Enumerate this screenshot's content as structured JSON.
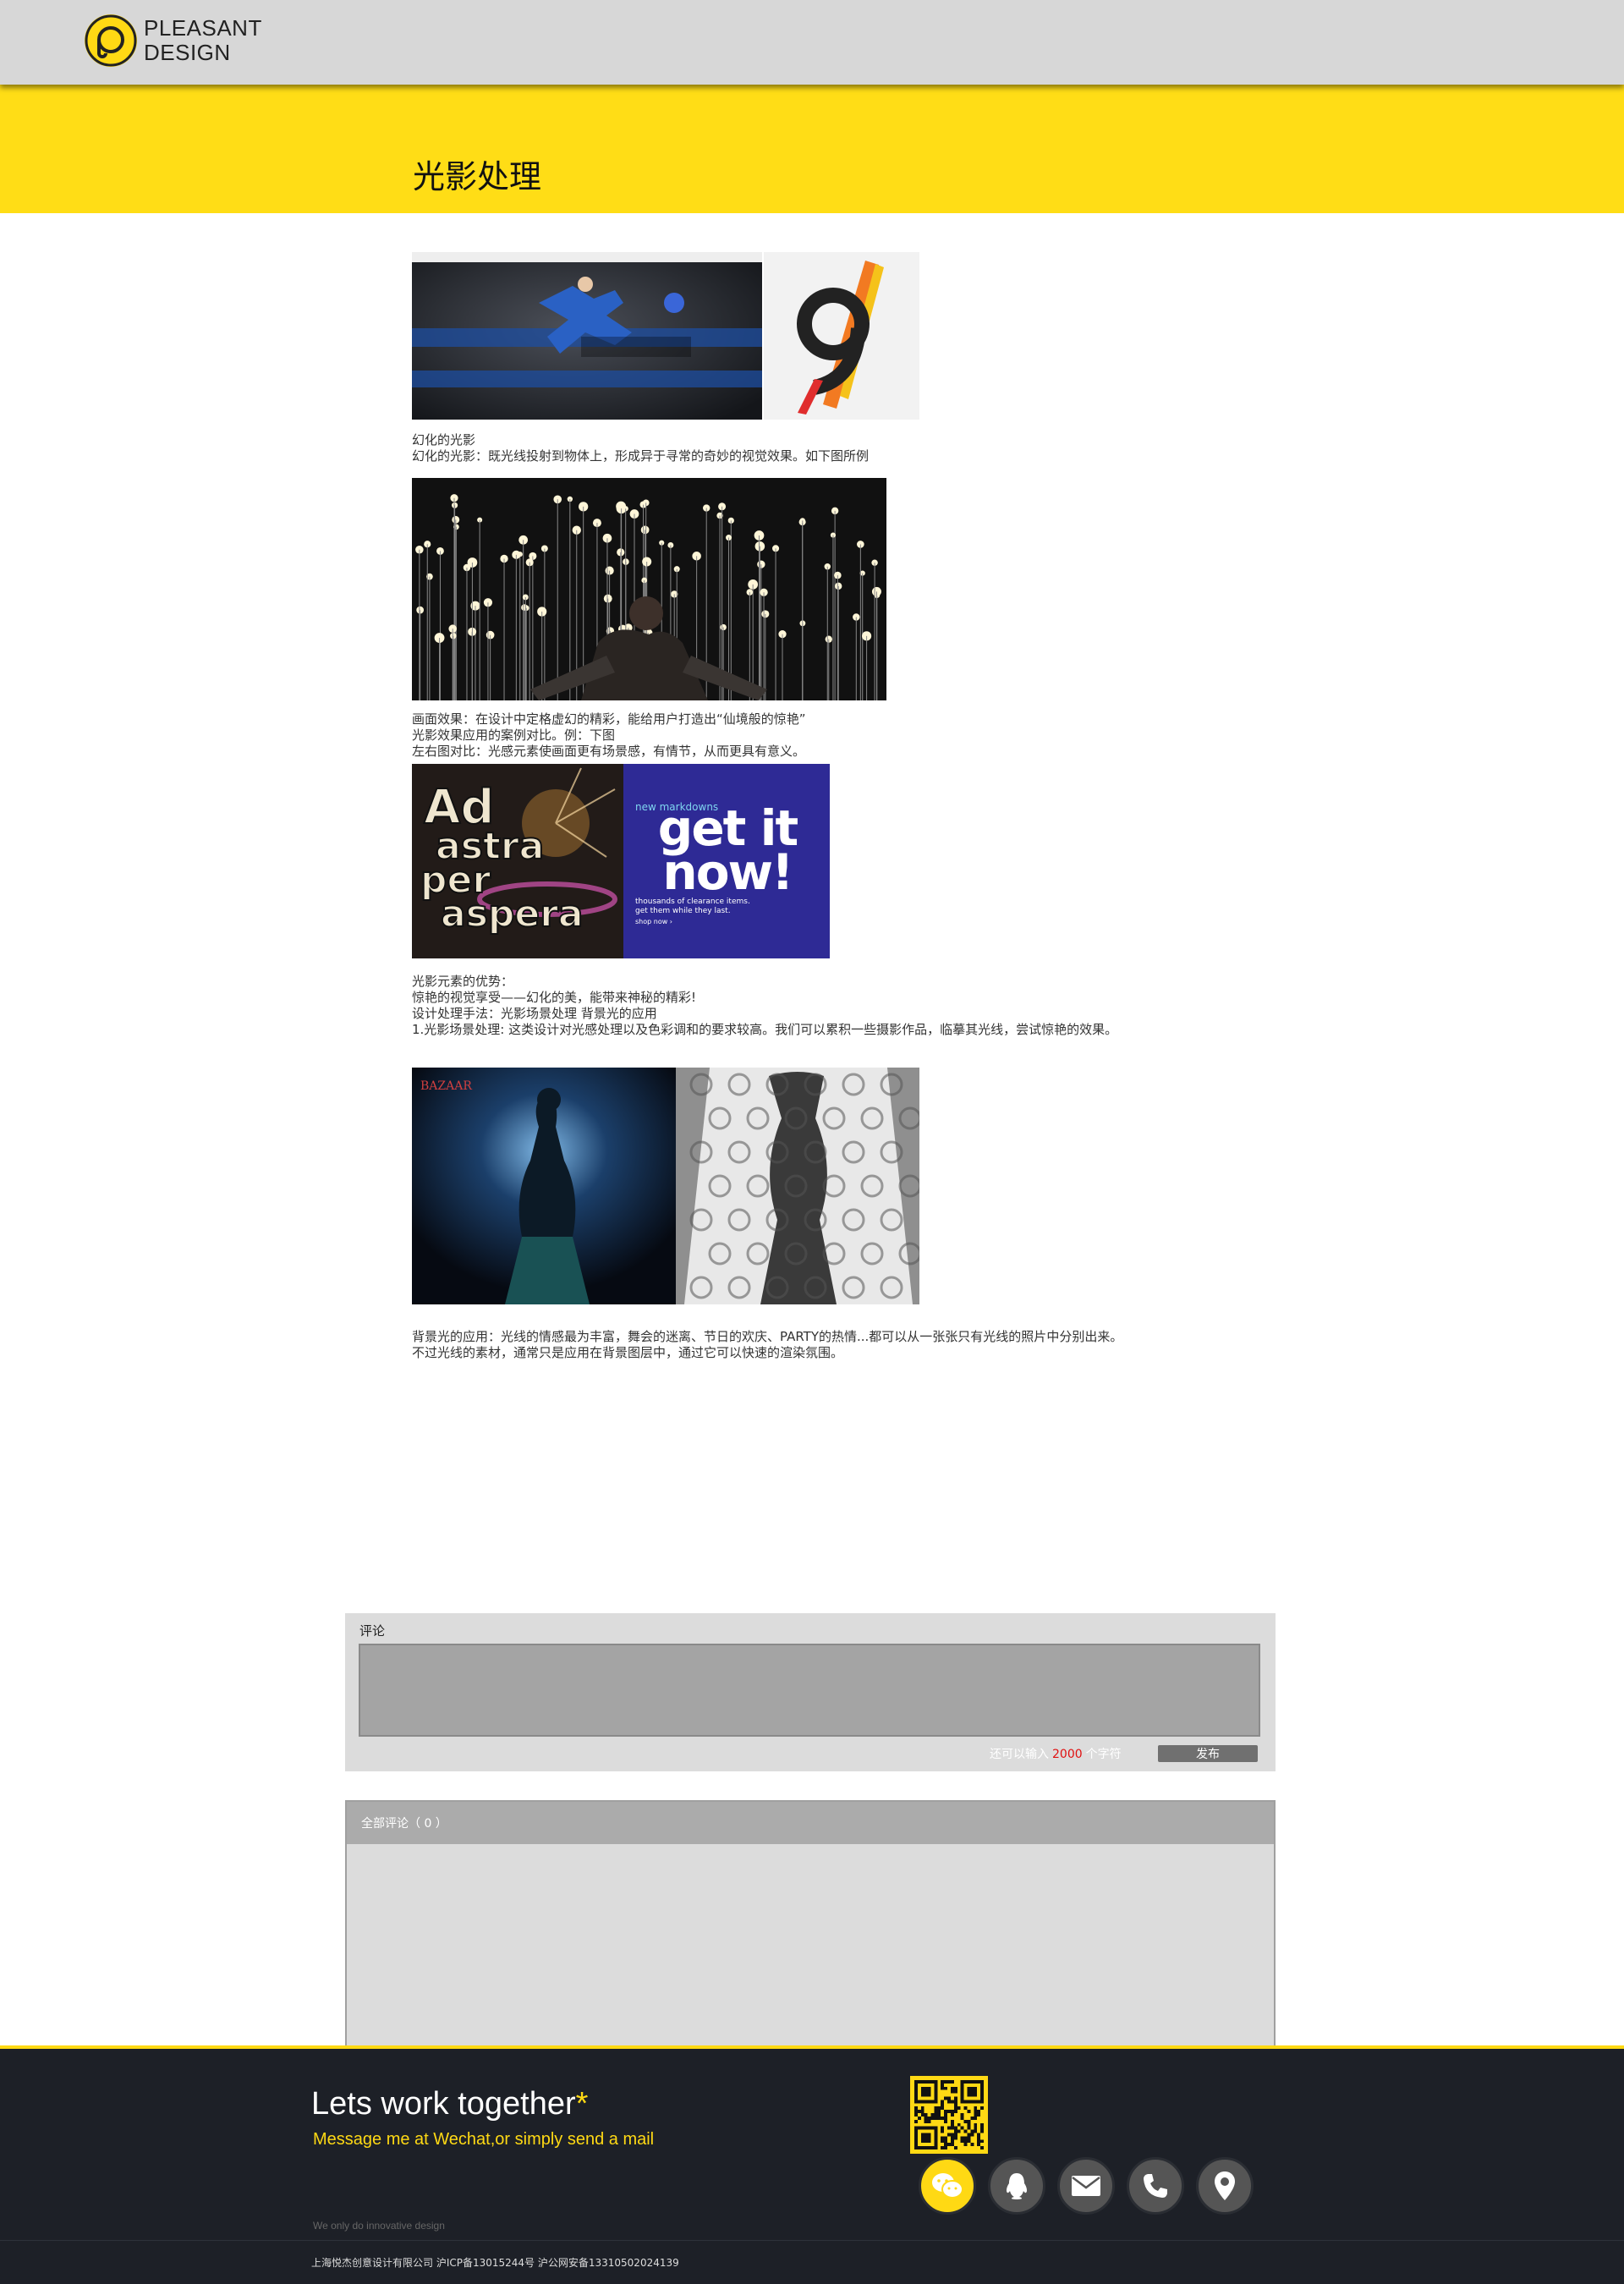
{
  "header": {
    "logo_line1": "PLEASANT",
    "logo_line2": "DESIGN"
  },
  "page_title": "光影处理",
  "article": {
    "images": [
      {
        "name": "soccer-banner-image",
        "desc": "soccer player banner"
      },
      {
        "name": "number-nine-image",
        "desc": "number 9 graphic"
      },
      {
        "name": "light-field-image",
        "desc": "field of light bulbs"
      },
      {
        "name": "ad-astra-poster-image",
        "desc": "Ad astra per aspera poster",
        "text": "Ad astra per aspera"
      },
      {
        "name": "get-it-now-image",
        "desc": "get it now ad",
        "top_text": "new markdowns",
        "headline": "get it now!",
        "sub1": "thousands of clearance items.",
        "sub2": "get them while they last.",
        "cta": "shop now ›"
      },
      {
        "name": "bazaar-woman-image",
        "desc": "Bazaar backlit woman",
        "text": "BAZAAR"
      },
      {
        "name": "lace-woman-image",
        "desc": "lace patterned figure"
      }
    ],
    "paragraphs": {
      "p1": "幻化的光影",
      "p2": "幻化的光影：既光线投射到物体上，形成异于寻常的奇妙的视觉效果。如下图所例",
      "p3": "画面效果：在设计中定格虚幻的精彩，能给用户打造出“仙境般的惊艳”",
      "p4": "光影效果应用的案例对比。例：下图",
      "p5": "左右图对比：光感元素使画面更有场景感，有情节，从而更具有意义。",
      "p6": "光影元素的优势：",
      "p7": "惊艳的视觉享受——幻化的美，能带来神秘的精彩!",
      "p8": "设计处理手法：光影场景处理 背景光的应用",
      "p9": "1.光影场景处理: 这类设计对光感处理以及色彩调和的要求较高。我们可以累积一些摄影作品，临摹其光线，尝试惊艳的效果。",
      "p10": "背景光的应用：光线的情感最为丰富，舞会的迷离、节日的欢庆、PARTY的热情...都可以从一张张只有光线的照片中分别出来。",
      "p11": "不过光线的素材，通常只是应用在背景图层中，通过它可以快速的渲染氛围。"
    }
  },
  "comment_form": {
    "label": "评论",
    "textarea_value": "",
    "counter_prefix": "还可以输入",
    "counter_value": "2000",
    "counter_suffix": "个字符",
    "publish_label": "发布"
  },
  "comments_list": {
    "header": "全部评论（ 0 ）"
  },
  "footer": {
    "headline": "Lets work together",
    "headline_star": "*",
    "subline": "Message me at Wechat,or simply send a mail",
    "slogan": "We only do innovative design",
    "copyright": "上海悦杰创意设计有限公司  沪ICP备13015244号  沪公网安备13310502024139",
    "icons": [
      "wechat-icon",
      "qq-icon",
      "mail-icon",
      "phone-icon",
      "location-icon"
    ],
    "accent_color": "#ffd914"
  },
  "colors": {
    "yellow": "#ffdd16",
    "header_gray": "#d7d7d7",
    "footer_bg": "#1d2027"
  }
}
